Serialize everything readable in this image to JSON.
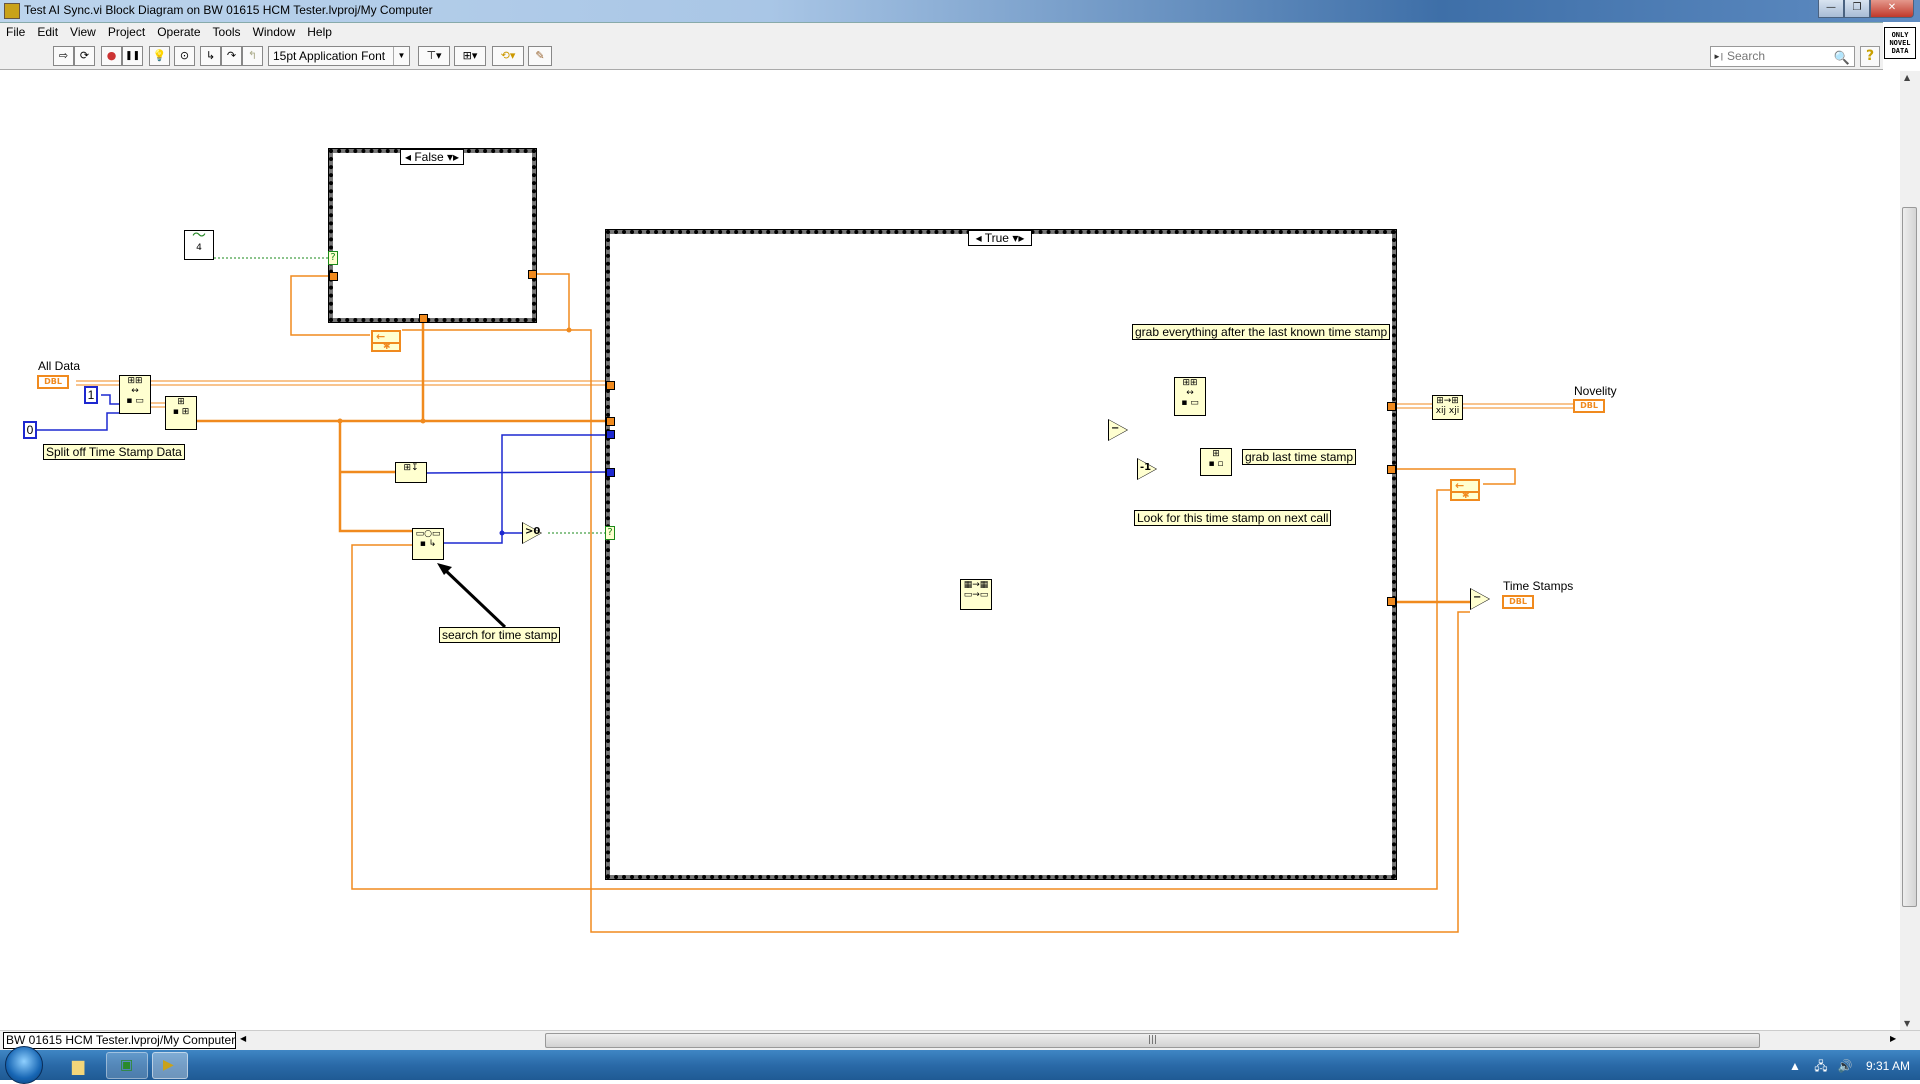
{
  "window": {
    "title": "Test AI Sync.vi Block Diagram on BW 01615 HCM Tester.lvproj/My Computer",
    "controls": {
      "minimize": "—",
      "restore": "❐",
      "close": "✕"
    }
  },
  "menu": [
    "File",
    "Edit",
    "View",
    "Project",
    "Operate",
    "Tools",
    "Window",
    "Help"
  ],
  "toolbar": {
    "buttons": [
      {
        "name": "run",
        "icon": "⇨"
      },
      {
        "name": "run-continuously",
        "icon": "⟳"
      },
      {
        "name": "abort",
        "icon": "●"
      },
      {
        "name": "pause",
        "icon": "❚❚"
      },
      {
        "name": "highlight-execution",
        "icon": "💡"
      },
      {
        "name": "retain-wire-values",
        "icon": "⊙"
      },
      {
        "name": "step-into",
        "icon": "↳"
      },
      {
        "name": "step-over",
        "icon": "↷"
      },
      {
        "name": "step-out",
        "icon": "↰"
      }
    ],
    "font_select": "15pt Application Font",
    "tools": [
      {
        "name": "align-objects",
        "icon": "⊤▾"
      },
      {
        "name": "distribute-objects",
        "icon": "⊞▾"
      },
      {
        "name": "reorder",
        "icon": "⟲▾"
      },
      {
        "name": "cleanup-diagram",
        "icon": "✎"
      }
    ],
    "search_placeholder": "Search",
    "help_icon": "?",
    "vi_icon_text": "ONLY NOVEL DATA"
  },
  "diagram": {
    "case_false": {
      "selector": "False"
    },
    "case_true": {
      "selector": "True"
    },
    "labels": {
      "all_data": "All Data",
      "novelity": "Novelity",
      "time_stamps": "Time Stamps"
    },
    "terminal_type": "DBL",
    "constants": {
      "one": "1",
      "zero": "0"
    },
    "first_call_node_label": "4",
    "comments": {
      "split": "Split off Time Stamp Data",
      "search": "search for time stamp",
      "grab_everything": "grab everything after the last known time stamp",
      "grab_last": "grab last time stamp",
      "look_for": "Look for this time stamp on next call"
    },
    "primitives": {
      "greater_zero": ">0",
      "subtract": "−",
      "decrement": "-1",
      "subtract2": "−"
    }
  },
  "statusbar": {
    "project_path": "BW 01615 HCM Tester.lvproj/My Computer"
  },
  "taskbar": {
    "clock": "9:31 AM"
  }
}
